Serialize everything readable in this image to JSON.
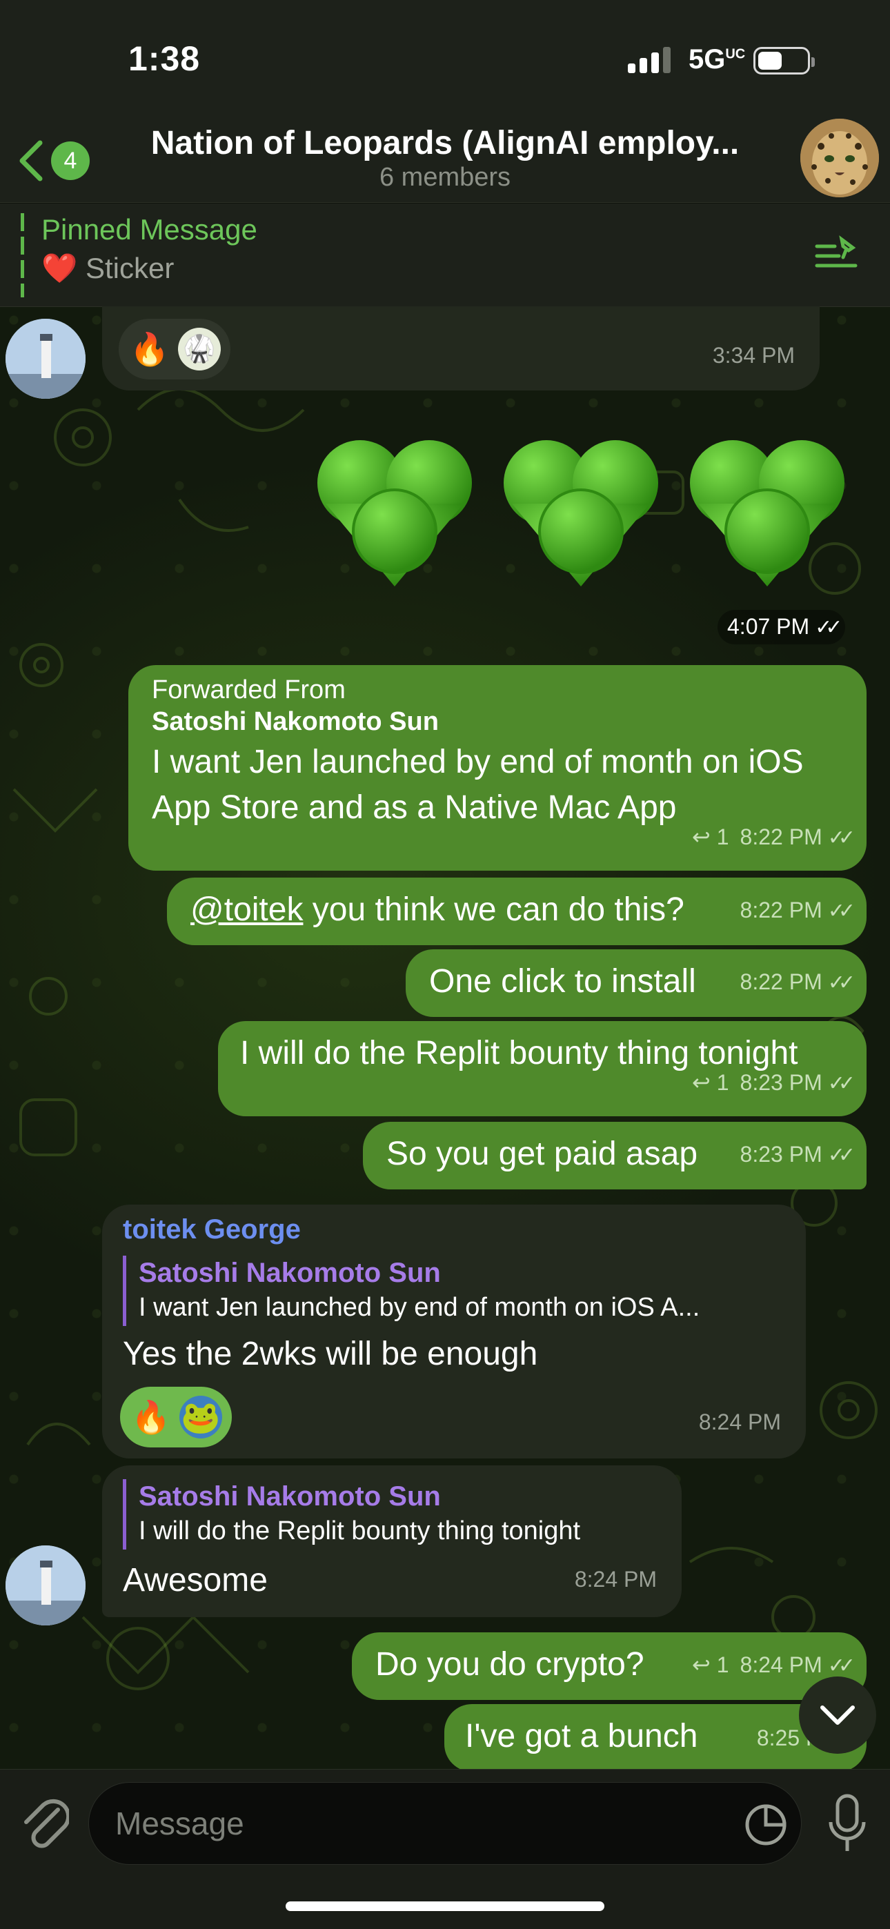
{
  "status_bar": {
    "time": "1:38",
    "network": "5G",
    "network_suffix": "UC"
  },
  "header": {
    "back_count": "4",
    "title": "Nation of Leopards (AlignAI employ...",
    "subtitle": "6 members"
  },
  "pinned": {
    "title": "Pinned Message",
    "emoji": "❤️",
    "text": "Sticker"
  },
  "messages": [
    {
      "reactions": [
        "🔥",
        "🥋"
      ],
      "time": "3:34 PM"
    },
    {
      "sticker": "💚💚💚",
      "time": "4:07 PM",
      "ticks": "✓✓"
    },
    {
      "forwarded_label": "Forwarded From",
      "forwarded_name": "Satoshi Nakomoto Sun",
      "line1": "I want Jen launched by end of month on iOS",
      "line2": "App Store and as a Native Mac App",
      "reply_count": "↩ 1",
      "time": "8:22 PM",
      "ticks": "✓✓"
    },
    {
      "mention": "@toitek",
      "text": " you think we can do this?",
      "time": "8:22 PM",
      "ticks": "✓✓"
    },
    {
      "text": "One click to install",
      "time": "8:22 PM",
      "ticks": "✓✓"
    },
    {
      "text": "I will do the Replit bounty thing tonight",
      "reply_count": "↩ 1",
      "time": "8:23 PM",
      "ticks": "✓✓"
    },
    {
      "text": "So you get paid asap",
      "time": "8:23 PM",
      "ticks": "✓✓"
    },
    {
      "sender": "toitek George",
      "quote_name": "Satoshi Nakomoto Sun",
      "quote_text": "I want Jen launched by end of month on iOS A...",
      "text": "Yes the 2wks will be enough",
      "reactions": [
        "🔥",
        "🐸"
      ],
      "time": "8:24 PM"
    },
    {
      "quote_name": "Satoshi Nakomoto Sun",
      "quote_text": "I will do the Replit bounty thing tonight",
      "text": "Awesome",
      "time": "8:24 PM"
    },
    {
      "text": "Do you do crypto?",
      "reply_count": "↩ 1",
      "time": "8:24 PM",
      "ticks": "✓✓"
    },
    {
      "text": "I've got a bunch",
      "time": "8:25 PM"
    }
  ],
  "composer": {
    "placeholder": "Message"
  },
  "colors": {
    "accent": "#5eb74a",
    "outgoing_bubble": "#4f8a2b",
    "incoming_bubble": "#23291e",
    "quote_name": "#a67ce8",
    "sender_name": "#6d8ff0"
  }
}
